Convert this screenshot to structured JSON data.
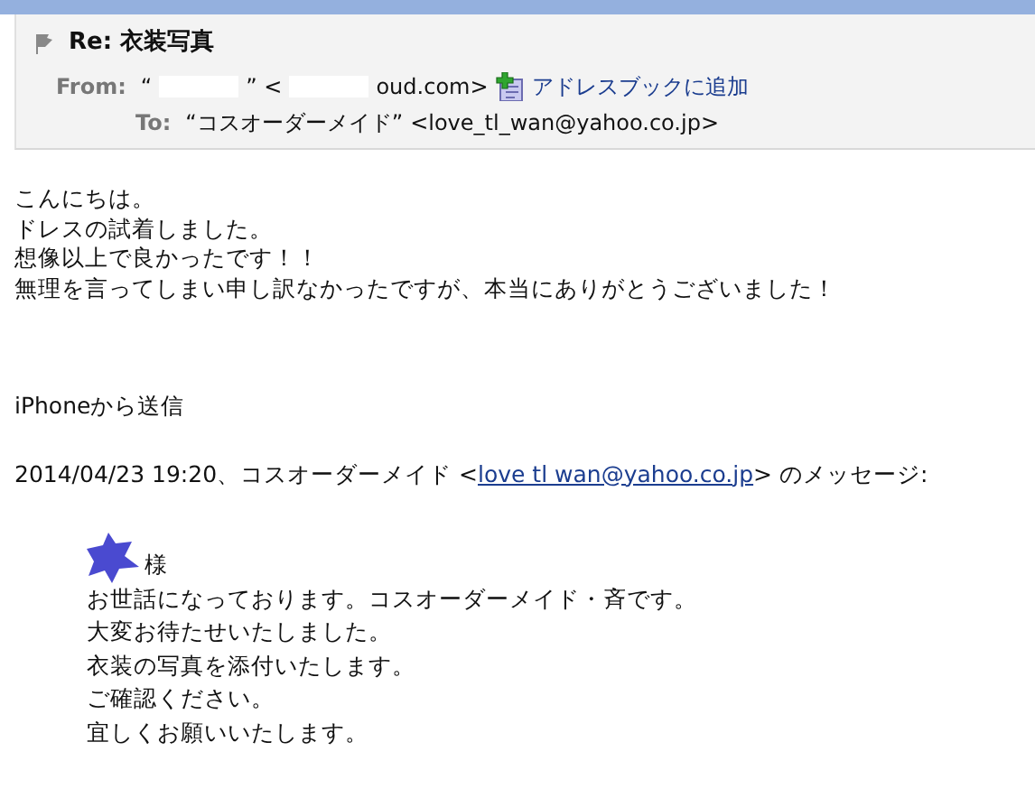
{
  "header": {
    "subject": "Re: 衣装写真",
    "from": {
      "label": "From:",
      "segments": [
        {
          "kind": "text",
          "text": "“"
        },
        {
          "kind": "redacted"
        },
        {
          "kind": "text",
          "text": "” <"
        },
        {
          "kind": "redacted"
        },
        {
          "kind": "text",
          "text": "oud.com>"
        }
      ],
      "add_link": "アドレスブックに追加"
    },
    "to": {
      "label": "To:",
      "name": "“コスオーダーメイド”",
      "address": "<love_tl_wan@yahoo.co.jp>"
    }
  },
  "body": {
    "paragraphs": [
      [
        "こんにちは。",
        "ドレスの試着しました。",
        "想像以上で良かったです！！",
        "無理を言ってしまい申し訳なかったですが、本当にありがとうございました！"
      ],
      [
        "iPhoneから送信"
      ]
    ],
    "quote_intro": {
      "before": "2014/04/23 19:20、コスオーダーメイド <",
      "link": "love tl wan@yahoo.co.jp",
      "after": "> のメッセージ:"
    },
    "quote": {
      "greeting": [
        {
          "kind": "scribble"
        },
        {
          "kind": "text",
          "text": "様"
        }
      ],
      "lines": [
        "お世話になっております。コスオーダーメイド・斉です。",
        "大変お待たせいたしました。",
        "衣装の写真を添付いたします。",
        "ご確認ください。",
        "宜しくお願いいたします。"
      ]
    }
  }
}
